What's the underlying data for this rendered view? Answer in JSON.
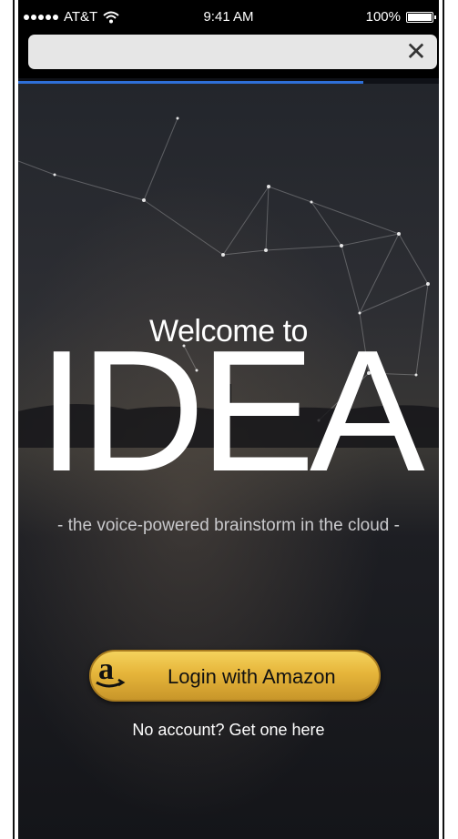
{
  "status_bar": {
    "carrier": "AT&T",
    "time": "9:41 AM",
    "battery": "100%"
  },
  "browser": {
    "url": "",
    "close_icon": "close-icon",
    "load_progress": 0.82
  },
  "hero": {
    "welcome": "Welcome to",
    "title": "IDEA",
    "tagline": "- the voice-powered brainstorm in the cloud -"
  },
  "actions": {
    "login_label": "Login with Amazon",
    "login_icon": "amazon-logo-icon",
    "signup_link": "No account? Get one here"
  },
  "colors": {
    "progress": "#2e6fd8",
    "button_gold": "#e6b53a"
  }
}
